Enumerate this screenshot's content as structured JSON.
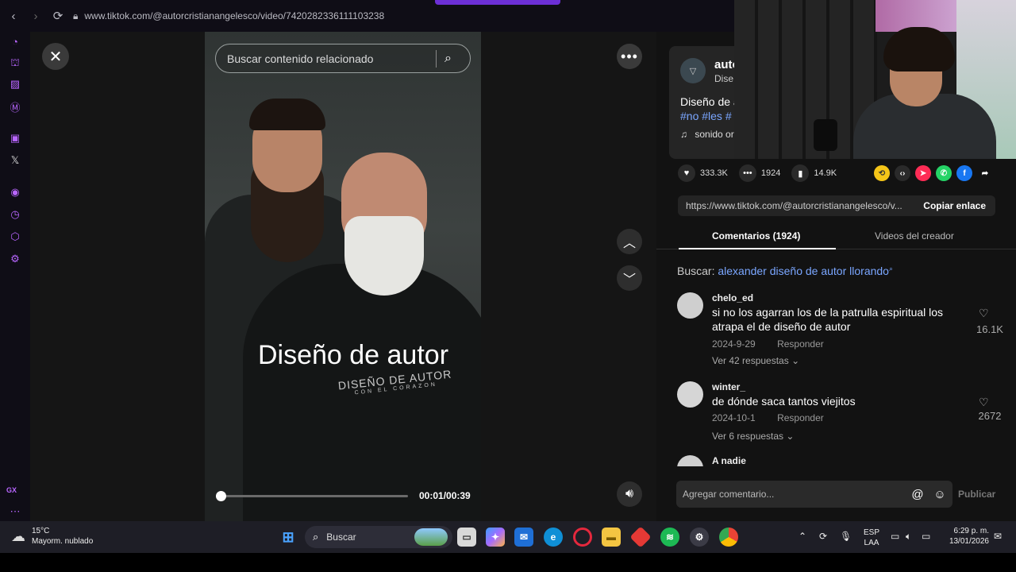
{
  "browser": {
    "url": "www.tiktok.com/@autorcristianangelesco/video/7420282336111103238",
    "sidebar_label": "GX"
  },
  "video": {
    "search_placeholder": "Buscar contenido relacionado",
    "overlay_text": "Diseño de autor",
    "cape_logo": "DISEÑO DE AUTOR",
    "cape_logo_sub": "CON EL CORAZON",
    "timecode": "00:01/00:39",
    "progress_fraction": 0.026
  },
  "author": {
    "name": "auto",
    "sub": "Dise",
    "description": "Diseño de a",
    "tags": "#no #les #",
    "sound": "sonido or"
  },
  "actions": {
    "likes": "333.3K",
    "comments": "1924",
    "saves": "14.9K"
  },
  "share": {
    "link": "https://www.tiktok.com/@autorcristianangelesco/v...",
    "copy_label": "Copiar enlace"
  },
  "tabs": {
    "comments": "Comentarios (1924)",
    "creator_videos": "Videos del creador"
  },
  "related": {
    "label": "Buscar:",
    "query": "alexander diseño de autor llorando"
  },
  "comments": [
    {
      "user": "chelo_ed",
      "text": "si no los agarran los de la patrulla espiritual los atrapa el de diseño de autor",
      "date": "2024-9-29",
      "reply": "Responder",
      "replies": "Ver 42 respuestas",
      "likes": "16.1K"
    },
    {
      "user": "winter_",
      "text": "de dónde saca tantos viejitos",
      "date": "2024-10-1",
      "reply": "Responder",
      "replies": "Ver 6 respuestas",
      "likes": "2672"
    },
    {
      "user": "A nadie"
    }
  ],
  "composer": {
    "placeholder": "Agregar comentario...",
    "publish": "Publicar"
  },
  "taskbar": {
    "temp": "15°C",
    "weather": "Mayorm. nublado",
    "search": "Buscar",
    "lang1": "ESP",
    "lang2": "LAA",
    "time": "6:29 p. m.",
    "date": "13/01/2026"
  },
  "colors": {
    "accent": "#b866ff",
    "link": "#7aa6ff",
    "opera_red": "#e5283d"
  }
}
